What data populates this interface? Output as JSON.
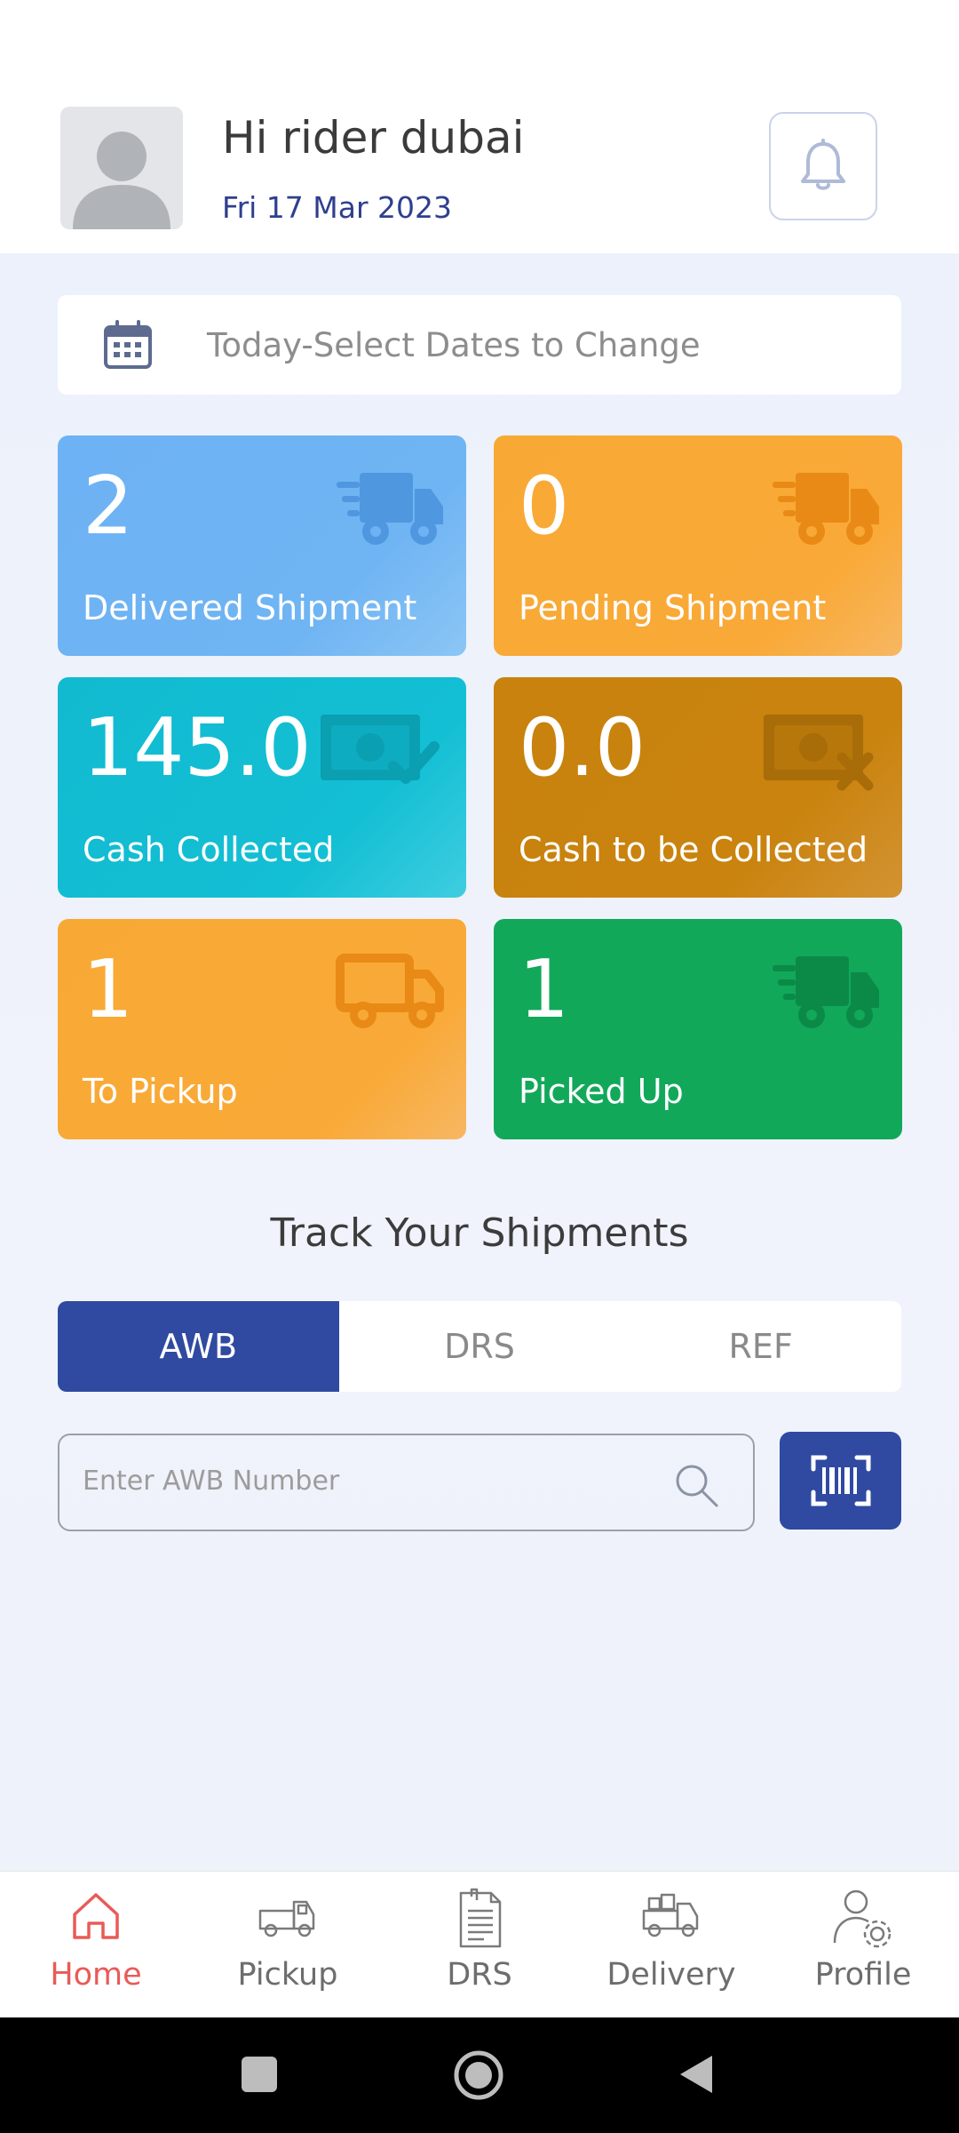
{
  "header": {
    "greeting": "Hi rider dubai",
    "date": "Fri 17 Mar 2023"
  },
  "date_filter": {
    "label": "Today-Select Dates to Change"
  },
  "stats": [
    {
      "value": "2",
      "label": "Delivered Shipment",
      "color": "#6db2f4"
    },
    {
      "value": "0",
      "label": "Pending Shipment",
      "color": "#f8a935"
    },
    {
      "value": "145.0",
      "label": "Cash Collected",
      "color": "#12bad0"
    },
    {
      "value": "0.0",
      "label": "Cash to be Collected",
      "color": "#c8820d"
    },
    {
      "value": "1",
      "label": "To Pickup",
      "color": "#f8a935"
    },
    {
      "value": "1",
      "label": "Picked Up",
      "color": "#12a85a"
    }
  ],
  "track": {
    "title": "Track Your Shipments",
    "tabs": [
      {
        "label": "AWB",
        "active": true
      },
      {
        "label": "DRS",
        "active": false
      },
      {
        "label": "REF",
        "active": false
      }
    ],
    "search_placeholder": "Enter AWB Number"
  },
  "bottom_nav": [
    {
      "label": "Home",
      "icon": "home-icon",
      "active": true
    },
    {
      "label": "Pickup",
      "icon": "pickup-truck-icon",
      "active": false
    },
    {
      "label": "DRS",
      "icon": "document-icon",
      "active": false
    },
    {
      "label": "Delivery",
      "icon": "delivery-truck-icon",
      "active": false
    },
    {
      "label": "Profile",
      "icon": "profile-gear-icon",
      "active": false
    }
  ],
  "colors": {
    "primary": "#2f4aa0",
    "accent_active_nav": "#e85b57"
  }
}
